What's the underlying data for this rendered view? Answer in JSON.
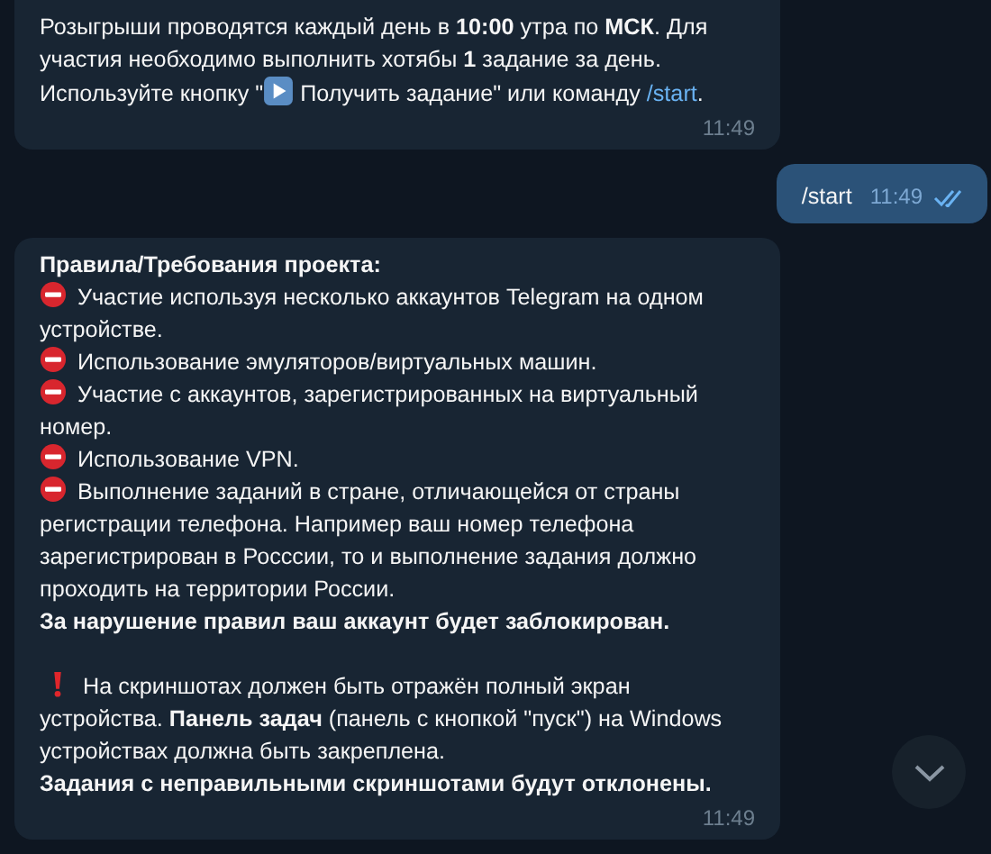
{
  "messages": [
    {
      "kind": "incoming",
      "paragraphs": [
        {
          "kind": "plain",
          "parts": [
            {
              "kind": "text",
              "text": "Розыгрыши проводятся каждый день в **10:00** утра по **МСК**. Для участия необходимо выполнить хотябы **1** задание за день. Используйте кнопку \""
            },
            {
              "kind": "play_icon"
            },
            {
              "kind": "text",
              "text": " Получить задание\" или команду "
            },
            {
              "kind": "link",
              "text": "/start"
            },
            {
              "kind": "text",
              "text": "."
            }
          ]
        }
      ],
      "time": "11:49"
    },
    {
      "kind": "outgoing",
      "paragraphs": [
        {
          "kind": "plain",
          "parts": [
            {
              "kind": "text",
              "text": "/start"
            }
          ]
        }
      ],
      "time": "11:49",
      "read": true
    },
    {
      "kind": "incoming",
      "paragraphs": [
        {
          "kind": "bold",
          "parts": [
            {
              "kind": "text",
              "text": "Правила/Требования проекта:"
            }
          ]
        },
        {
          "kind": "rule",
          "parts": [
            {
              "kind": "text",
              "text": "Участие используя несколько аккаунтов Telegram на одном устройстве."
            }
          ]
        },
        {
          "kind": "rule",
          "parts": [
            {
              "kind": "text",
              "text": "Использование эмуляторов/виртуальных машин."
            }
          ]
        },
        {
          "kind": "rule",
          "parts": [
            {
              "kind": "text",
              "text": "Участие с аккаунтов, зарегистрированных на виртуальный номер."
            }
          ]
        },
        {
          "kind": "rule",
          "parts": [
            {
              "kind": "text",
              "text": "Использование VPN."
            }
          ]
        },
        {
          "kind": "rule",
          "parts": [
            {
              "kind": "text",
              "text": "Выполнение заданий в стране, отличающейся от страны регистрации телефона. Например ваш номер телефона зарегистрирован в Росссии, то и выполнение задания должно проходить на территории России."
            }
          ]
        },
        {
          "kind": "bold",
          "parts": [
            {
              "kind": "text",
              "text": "За нарушение правил ваш аккаунт будет заблокирован."
            }
          ]
        },
        {
          "kind": "warning",
          "gap_before": true,
          "parts": [
            {
              "kind": "text",
              "text": "На скриншотах должен быть отражён полный экран устройства. **Панель задач** (панель с кнопкой \"пуск\") на Windows устройствах должна быть закреплена."
            }
          ]
        },
        {
          "kind": "bold",
          "parts": [
            {
              "kind": "text",
              "text": "Задания с неправильными скриншотами будут отклонены."
            }
          ]
        }
      ],
      "time": "11:49"
    }
  ]
}
